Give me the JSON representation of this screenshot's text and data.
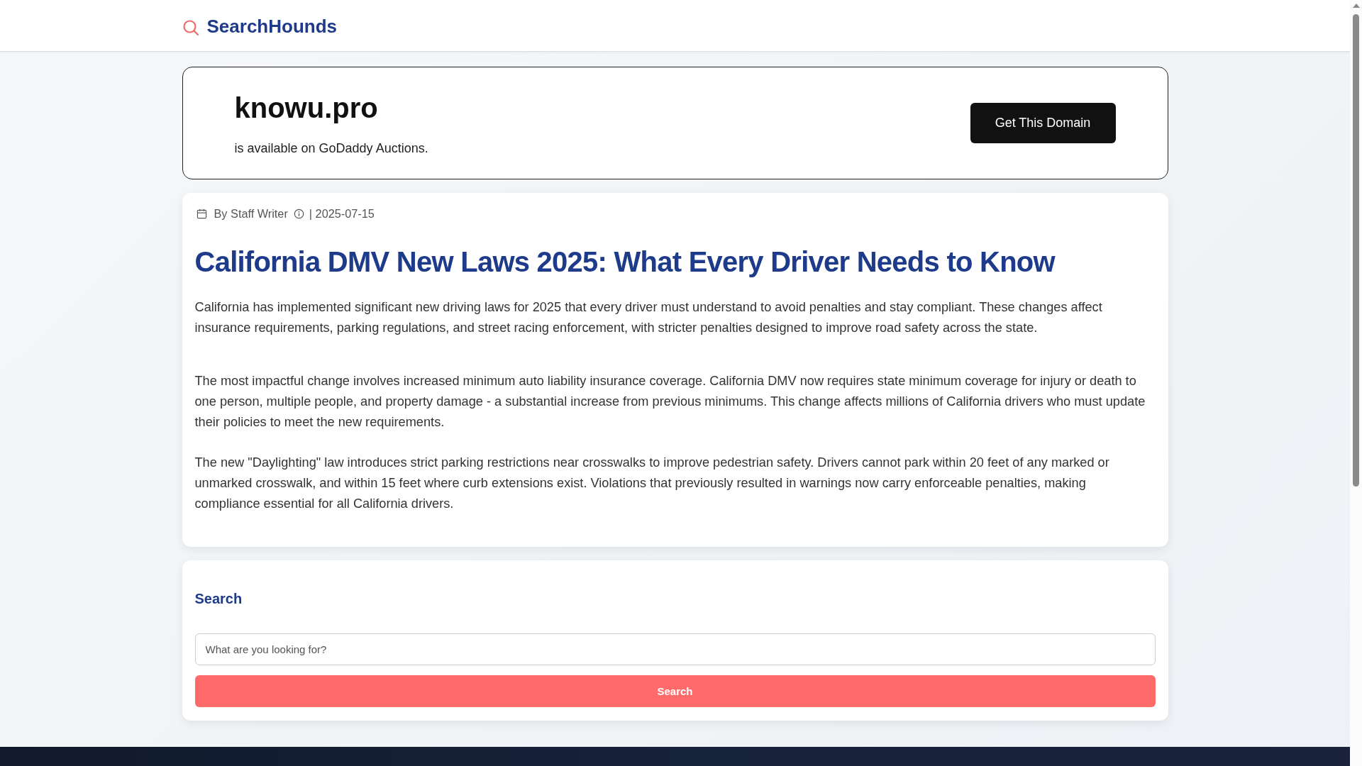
{
  "header": {
    "logo": "SearchHounds"
  },
  "domain_banner": {
    "domain": "knowu.pro",
    "message": "is available on GoDaddy Auctions.",
    "button": "Get This Domain"
  },
  "article": {
    "author": "By Staff Writer",
    "date": "| 2025-07-15",
    "title": "California DMV New Laws 2025: What Every Driver Needs to Know",
    "paragraphs": [
      "California has implemented significant new driving laws for 2025 that every driver must understand to avoid penalties and stay compliant. These changes affect insurance requirements, parking regulations, and street racing enforcement, with stricter penalties designed to improve road safety across the state.",
      "The most impactful change involves increased minimum auto liability insurance coverage. California DMV now requires state minimum coverage for injury or death to one person, multiple people, and property damage - a substantial increase from previous minimums. This change affects millions of California drivers who must update their policies to meet the new requirements.",
      "The new \"Daylighting\" law introduces strict parking restrictions near crosswalks to improve pedestrian safety. Drivers cannot park within 20 feet of any marked or unmarked crosswalk, and within 15 feet where curb extensions exist. Violations that previously resulted in warnings now carry enforceable penalties, making compliance essential for all California drivers."
    ]
  },
  "search": {
    "heading": "Search",
    "placeholder": "What are you looking for?",
    "button": "Search"
  }
}
